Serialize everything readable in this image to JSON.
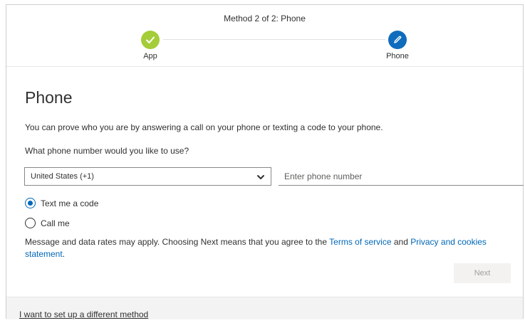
{
  "header": {
    "method_title": "Method 2 of 2: Phone",
    "steps": [
      {
        "label": "App",
        "state": "completed",
        "icon": "checkmark-icon",
        "color": "#a4cd39"
      },
      {
        "label": "Phone",
        "state": "current",
        "icon": "pencil-icon",
        "color": "#0f6cbd"
      }
    ]
  },
  "main": {
    "title": "Phone",
    "intro": "You can prove who you are by answering a call on your phone or texting a code to your phone.",
    "question": "What phone number would you like to use?",
    "country_select": {
      "value": "United States (+1)"
    },
    "phone_input": {
      "value": "",
      "placeholder": "Enter phone number"
    },
    "options": [
      {
        "label": "Text me a code",
        "checked": true
      },
      {
        "label": "Call me",
        "checked": false
      }
    ],
    "disclaimer": {
      "prefix": "Message and data rates may apply. Choosing Next means that you agree to the ",
      "terms_link": "Terms of service",
      "middle": " and ",
      "privacy_link": "Privacy and cookies statement",
      "suffix": "."
    },
    "next_label": "Next"
  },
  "footer": {
    "different_method_link": "I want to set up a different method"
  },
  "colors": {
    "accent": "#0067b8",
    "step_complete": "#a4cd39",
    "step_current": "#0f6cbd"
  }
}
